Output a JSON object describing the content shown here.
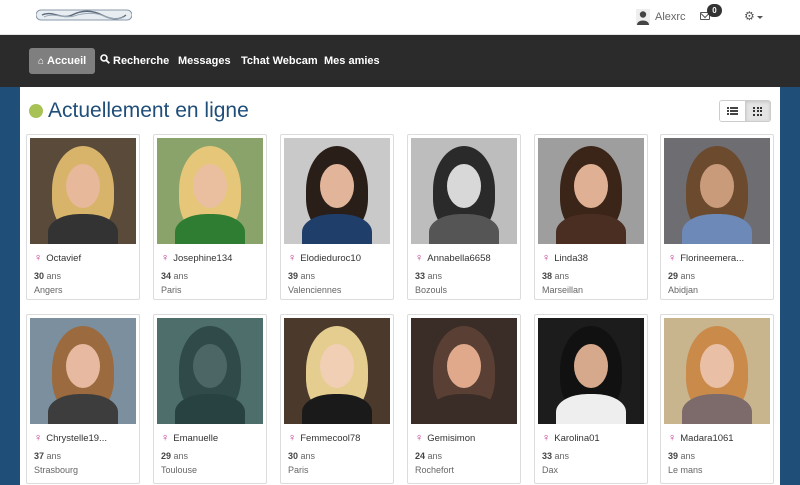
{
  "header": {
    "user_name": "Alexrc",
    "messages_count": "0",
    "icons": {
      "user": "user-avatar-icon",
      "mail": "envelope-icon",
      "settings": "gear-icon"
    }
  },
  "nav": {
    "items": [
      {
        "label": "Accueil",
        "icon": "home-icon",
        "active": true
      },
      {
        "label": "Recherche",
        "icon": "search-icon",
        "active": false
      },
      {
        "label": "Messages",
        "active": false
      },
      {
        "label": "Tchat Webcam",
        "active": false
      },
      {
        "label": "Mes amies",
        "active": false
      }
    ]
  },
  "main": {
    "title": "Actuellement en ligne",
    "status_color": "#a8c256",
    "view_modes": [
      "list",
      "grid"
    ],
    "active_view": "grid"
  },
  "age_unit": "ans",
  "profiles": [
    {
      "name": "Octavief",
      "age": "30",
      "city": "Angers",
      "bg": "#5a4a3a",
      "hair": "#d8b36a",
      "skin": "#e7b89a",
      "top": "#333333"
    },
    {
      "name": "Josephine134",
      "age": "34",
      "city": "Paris",
      "bg": "#8aa36a",
      "hair": "#e6c77a",
      "skin": "#e9bfa0",
      "top": "#2e7d32"
    },
    {
      "name": "Elodieduroc10",
      "age": "39",
      "city": "Valenciennes",
      "bg": "#c9c9c9",
      "hair": "#2a1e18",
      "skin": "#e2b49a",
      "top": "#1f3f6a"
    },
    {
      "name": "Annabella6658",
      "age": "33",
      "city": "Bozouls",
      "bg": "#bdbdbd",
      "hair": "#2a2a2a",
      "skin": "#d8d8d8",
      "top": "#555555"
    },
    {
      "name": "Linda38",
      "age": "38",
      "city": "Marseillan",
      "bg": "#9e9e9e",
      "hair": "#3b2418",
      "skin": "#e0b095",
      "top": "#4a2e22"
    },
    {
      "name": "Florineemera...",
      "age": "29",
      "city": "Abidjan",
      "bg": "#6d6d72",
      "hair": "#6b4a2e",
      "skin": "#c99b7a",
      "top": "#6d89b8"
    },
    {
      "name": "Chrystelle19...",
      "age": "37",
      "city": "Strasbourg",
      "bg": "#7b8f9e",
      "hair": "#9b6a3e",
      "skin": "#e6b9a0",
      "top": "#3d3d3d"
    },
    {
      "name": "Emanuelle",
      "age": "29",
      "city": "Toulouse",
      "bg": "#4d6e6b",
      "hair": "#2f4a48",
      "skin": "#4b6664",
      "top": "#274240"
    },
    {
      "name": "Femmecool78",
      "age": "30",
      "city": "Paris",
      "bg": "#4b3a2c",
      "hair": "#e5cd8f",
      "skin": "#f0cfb4",
      "top": "#1a1a1a"
    },
    {
      "name": "Gemisimon",
      "age": "24",
      "city": "Rochefort",
      "bg": "#3a2c26",
      "hair": "#5a4034",
      "skin": "#e0a98c",
      "top": "#3a2c26"
    },
    {
      "name": "Karolina01",
      "age": "33",
      "city": "Dax",
      "bg": "#1c1c1c",
      "hair": "#111111",
      "skin": "#d7a98c",
      "top": "#eeeeee"
    },
    {
      "name": "Madara1061",
      "age": "39",
      "city": "Le mans",
      "bg": "#c8b58e",
      "hair": "#c98a4a",
      "skin": "#e9c0a6",
      "top": "#7d6a6a"
    }
  ]
}
